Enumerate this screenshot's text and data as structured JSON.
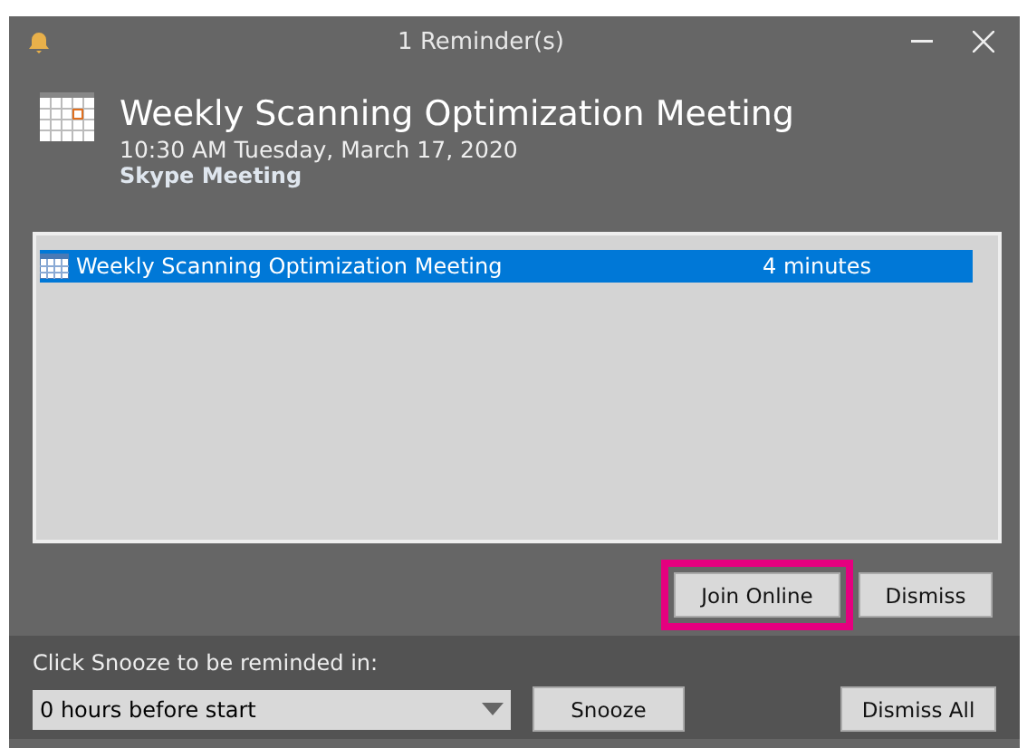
{
  "window": {
    "title": "1 Reminder(s)"
  },
  "header": {
    "title": "Weekly Scanning Optimization Meeting",
    "when": "10:30 AM Tuesday, March 17, 2020",
    "location": "Skype Meeting"
  },
  "reminders": [
    {
      "subject": "Weekly Scanning Optimization Meeting",
      "due_in": "4 minutes",
      "selected": true
    }
  ],
  "actions": [
    {
      "label": "Join Online",
      "highlighted": true
    },
    {
      "label": "Dismiss",
      "highlighted": false
    }
  ],
  "snooze": {
    "prompt": "Click Snooze to be reminded in:",
    "value": "0 hours before start",
    "button": "Snooze",
    "dismiss_all": "Dismiss All"
  }
}
